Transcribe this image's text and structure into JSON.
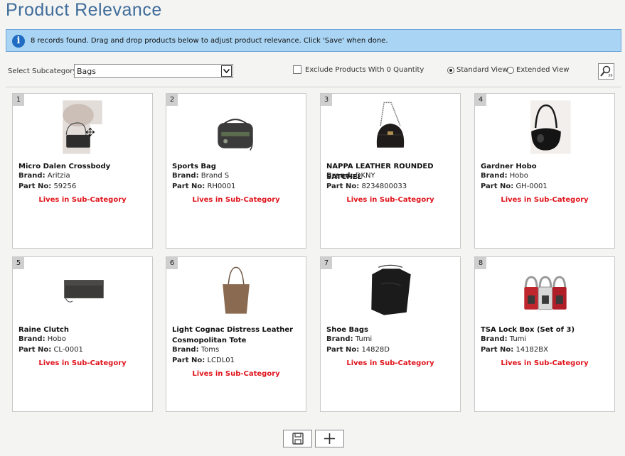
{
  "page": {
    "title": "Product Relevance"
  },
  "info": {
    "text": "8 records found. Drag and drop products below to adjust product relevance. Click 'Save' when done."
  },
  "filters": {
    "subcategory_label": "Select Subcategory:",
    "subcategory_value": "Bags",
    "exclude_label": "Exclude Products With 0 Quantity",
    "exclude_checked": false,
    "standard_view_label": "Standard View",
    "extended_view_label": "Extended View",
    "selected_view": "standard"
  },
  "labels": {
    "brand": "Brand:",
    "part_no": "Part No:",
    "lives": "Lives in Sub-Category"
  },
  "products": [
    {
      "num": "1",
      "name": "Micro Dalen Crossbody",
      "brand": "Aritzia",
      "part": "59256",
      "icon": "crossbody-bag-icon"
    },
    {
      "num": "2",
      "name": "Sports Bag",
      "brand": "Brand S",
      "part": "RH0001",
      "icon": "sports-bag-icon"
    },
    {
      "num": "3",
      "name": "NAPPA LEATHER ROUNDED SATCHEL",
      "brand": "DKNY",
      "part": "8234800033",
      "icon": "satchel-icon"
    },
    {
      "num": "4",
      "name": "Gardner Hobo",
      "brand": "Hobo",
      "part": "GH-0001",
      "icon": "hobo-bag-icon"
    },
    {
      "num": "5",
      "name": "Raine Clutch",
      "brand": "Hobo",
      "part": "CL-0001",
      "icon": "clutch-icon"
    },
    {
      "num": "6",
      "name": "Light Cognac Distress Leather Cosmopolitan Tote",
      "brand": "Toms",
      "part": "LCDL01",
      "icon": "tote-bag-icon"
    },
    {
      "num": "7",
      "name": "Shoe Bags",
      "brand": "Tumi",
      "part": "14828D",
      "icon": "shoe-bag-icon"
    },
    {
      "num": "8",
      "name": "TSA Lock Box (Set of 3)",
      "brand": "Tumi",
      "part": "14182BX",
      "icon": "padlock-icon"
    }
  ],
  "buttons": {
    "save": "save-icon",
    "add": "plus-icon"
  }
}
